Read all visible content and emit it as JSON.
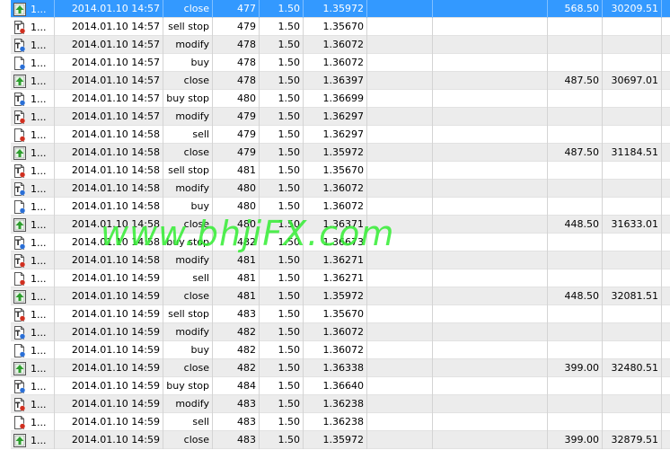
{
  "watermark": "www.bhjiFX.com",
  "rows": [
    {
      "n": "1...",
      "time": "2014.01.10 14:57",
      "type": "close",
      "order": "477",
      "size": "1.50",
      "price": "1.35972",
      "profit": "568.50",
      "balance": "30209.51",
      "icon": "close-up-arrow-icon",
      "selected": true
    },
    {
      "n": "1...",
      "time": "2014.01.10 14:57",
      "type": "sell stop",
      "order": "479",
      "size": "1.50",
      "price": "1.35670",
      "profit": "",
      "balance": "",
      "icon": "pending-order-red-icon"
    },
    {
      "n": "1...",
      "time": "2014.01.10 14:57",
      "type": "modify",
      "order": "478",
      "size": "1.50",
      "price": "1.36072",
      "profit": "",
      "balance": "",
      "icon": "modify-order-blue-icon"
    },
    {
      "n": "1...",
      "time": "2014.01.10 14:57",
      "type": "buy",
      "order": "478",
      "size": "1.50",
      "price": "1.36072",
      "profit": "",
      "balance": "",
      "icon": "buy-order-blue-icon"
    },
    {
      "n": "1...",
      "time": "2014.01.10 14:57",
      "type": "close",
      "order": "478",
      "size": "1.50",
      "price": "1.36397",
      "profit": "487.50",
      "balance": "30697.01",
      "icon": "close-up-arrow-icon"
    },
    {
      "n": "1...",
      "time": "2014.01.10 14:57",
      "type": "buy stop",
      "order": "480",
      "size": "1.50",
      "price": "1.36699",
      "profit": "",
      "balance": "",
      "icon": "pending-order-blue-icon"
    },
    {
      "n": "1...",
      "time": "2014.01.10 14:57",
      "type": "modify",
      "order": "479",
      "size": "1.50",
      "price": "1.36297",
      "profit": "",
      "balance": "",
      "icon": "modify-order-red-icon"
    },
    {
      "n": "1...",
      "time": "2014.01.10 14:58",
      "type": "sell",
      "order": "479",
      "size": "1.50",
      "price": "1.36297",
      "profit": "",
      "balance": "",
      "icon": "sell-order-red-icon"
    },
    {
      "n": "1...",
      "time": "2014.01.10 14:58",
      "type": "close",
      "order": "479",
      "size": "1.50",
      "price": "1.35972",
      "profit": "487.50",
      "balance": "31184.51",
      "icon": "close-up-arrow-icon"
    },
    {
      "n": "1...",
      "time": "2014.01.10 14:58",
      "type": "sell stop",
      "order": "481",
      "size": "1.50",
      "price": "1.35670",
      "profit": "",
      "balance": "",
      "icon": "pending-order-red-icon"
    },
    {
      "n": "1...",
      "time": "2014.01.10 14:58",
      "type": "modify",
      "order": "480",
      "size": "1.50",
      "price": "1.36072",
      "profit": "",
      "balance": "",
      "icon": "modify-order-blue-icon"
    },
    {
      "n": "1...",
      "time": "2014.01.10 14:58",
      "type": "buy",
      "order": "480",
      "size": "1.50",
      "price": "1.36072",
      "profit": "",
      "balance": "",
      "icon": "buy-order-blue-icon"
    },
    {
      "n": "1...",
      "time": "2014.01.10 14:58",
      "type": "close",
      "order": "480",
      "size": "1.50",
      "price": "1.36371",
      "profit": "448.50",
      "balance": "31633.01",
      "icon": "close-up-arrow-icon"
    },
    {
      "n": "1...",
      "time": "2014.01.10 14:58",
      "type": "buy stop",
      "order": "482",
      "size": "1.50",
      "price": "1.36673",
      "profit": "",
      "balance": "",
      "icon": "pending-order-blue-icon"
    },
    {
      "n": "1...",
      "time": "2014.01.10 14:58",
      "type": "modify",
      "order": "481",
      "size": "1.50",
      "price": "1.36271",
      "profit": "",
      "balance": "",
      "icon": "modify-order-red-icon"
    },
    {
      "n": "1...",
      "time": "2014.01.10 14:59",
      "type": "sell",
      "order": "481",
      "size": "1.50",
      "price": "1.36271",
      "profit": "",
      "balance": "",
      "icon": "sell-order-red-icon"
    },
    {
      "n": "1...",
      "time": "2014.01.10 14:59",
      "type": "close",
      "order": "481",
      "size": "1.50",
      "price": "1.35972",
      "profit": "448.50",
      "balance": "32081.51",
      "icon": "close-up-arrow-icon"
    },
    {
      "n": "1...",
      "time": "2014.01.10 14:59",
      "type": "sell stop",
      "order": "483",
      "size": "1.50",
      "price": "1.35670",
      "profit": "",
      "balance": "",
      "icon": "pending-order-red-icon"
    },
    {
      "n": "1...",
      "time": "2014.01.10 14:59",
      "type": "modify",
      "order": "482",
      "size": "1.50",
      "price": "1.36072",
      "profit": "",
      "balance": "",
      "icon": "modify-order-blue-icon"
    },
    {
      "n": "1...",
      "time": "2014.01.10 14:59",
      "type": "buy",
      "order": "482",
      "size": "1.50",
      "price": "1.36072",
      "profit": "",
      "balance": "",
      "icon": "buy-order-blue-icon"
    },
    {
      "n": "1...",
      "time": "2014.01.10 14:59",
      "type": "close",
      "order": "482",
      "size": "1.50",
      "price": "1.36338",
      "profit": "399.00",
      "balance": "32480.51",
      "icon": "close-up-arrow-icon"
    },
    {
      "n": "1...",
      "time": "2014.01.10 14:59",
      "type": "buy stop",
      "order": "484",
      "size": "1.50",
      "price": "1.36640",
      "profit": "",
      "balance": "",
      "icon": "pending-order-blue-icon"
    },
    {
      "n": "1...",
      "time": "2014.01.10 14:59",
      "type": "modify",
      "order": "483",
      "size": "1.50",
      "price": "1.36238",
      "profit": "",
      "balance": "",
      "icon": "modify-order-red-icon"
    },
    {
      "n": "1...",
      "time": "2014.01.10 14:59",
      "type": "sell",
      "order": "483",
      "size": "1.50",
      "price": "1.36238",
      "profit": "",
      "balance": "",
      "icon": "sell-order-red-icon"
    },
    {
      "n": "1...",
      "time": "2014.01.10 14:59",
      "type": "close",
      "order": "483",
      "size": "1.50",
      "price": "1.35972",
      "profit": "399.00",
      "balance": "32879.51",
      "icon": "close-up-arrow-icon"
    }
  ],
  "colors": {
    "selection": "#3399ff",
    "row_alt": "#ececec",
    "close_icon_green": "#2e9e2e",
    "marker_red": "#d03020",
    "marker_blue": "#2a6fd6",
    "watermark": "#33ee33"
  }
}
